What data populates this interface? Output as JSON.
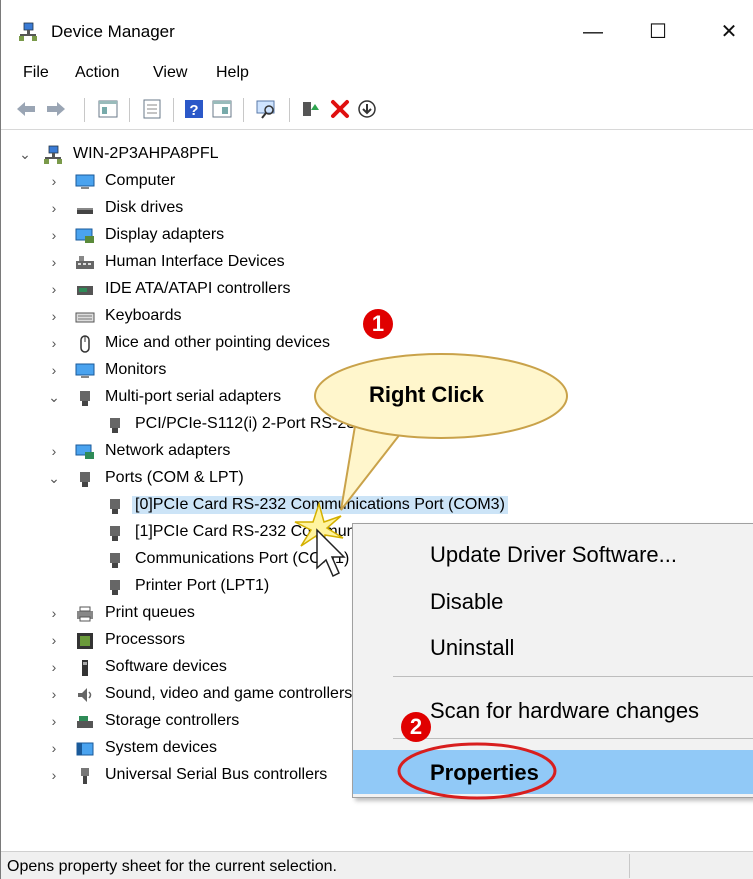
{
  "window": {
    "title": "Device Manager",
    "minimize": "—",
    "maximize": "☐",
    "close": "✕"
  },
  "menu": [
    "File",
    "Action",
    "View",
    "Help"
  ],
  "tree": {
    "root": "WIN-2P3AHPA8PFL",
    "items": [
      "Computer",
      "Disk drives",
      "Display adapters",
      "Human Interface Devices",
      "IDE ATA/ATAPI controllers",
      "Keyboards",
      "Mice and other pointing devices",
      "Monitors",
      "Multi-port serial adapters",
      "PCI/PCIe-S112(i) 2-Port RS-232 Communication Board",
      "Network adapters",
      "Ports (COM & LPT)",
      "[0]PCIe Card RS-232 Communications Port (COM3)",
      "[1]PCIe Card RS-232 Communications Port (COM4)",
      "Communications Port (COM1)",
      "Printer Port (LPT1)",
      "Print queues",
      "Processors",
      "Software devices",
      "Sound, video and game controllers",
      "Storage controllers",
      "System devices",
      "Universal Serial Bus controllers"
    ]
  },
  "context_menu": {
    "update": "Update Driver Software...",
    "disable": "Disable",
    "uninstall": "Uninstall",
    "scan": "Scan for hardware changes",
    "properties": "Properties"
  },
  "callout": {
    "text": "Right Click",
    "step1": "1",
    "step2": "2"
  },
  "status": "Opens property sheet for the current selection.",
  "colors": {
    "selection": "#cce4f7",
    "menu_highlight": "#91c9f7",
    "badge": "#e00000",
    "callout_fill": "#fff6cc",
    "callout_stroke": "#c9a24a"
  }
}
